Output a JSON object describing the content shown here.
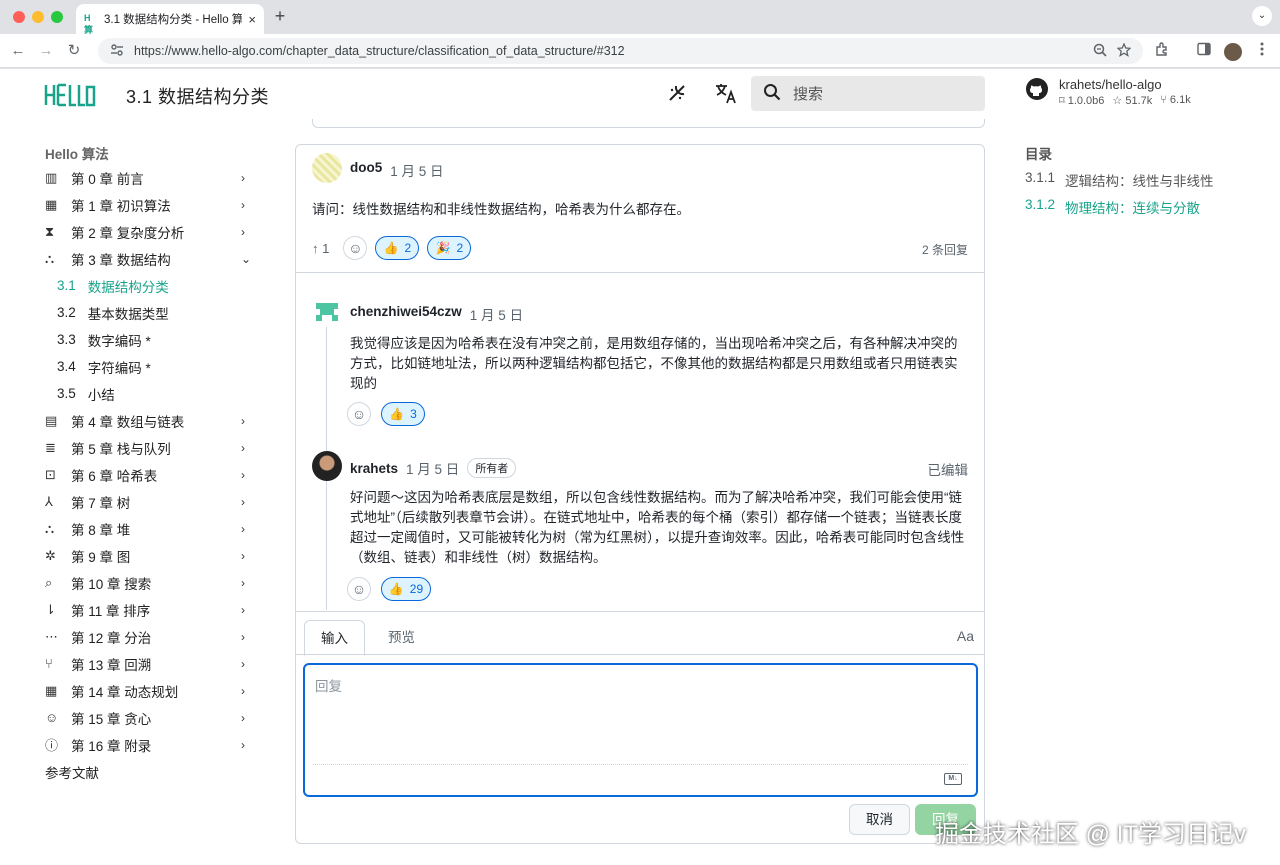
{
  "browser": {
    "tab_title": "3.1  数据结构分类 - Hello 算法",
    "tab_favicon": "H算",
    "tab_close": "×",
    "new_tab": "+",
    "tab_menu": "⌄",
    "url": "https://www.hello-algo.com/chapter_data_structure/classification_of_data_structure/#312",
    "back": "←",
    "forward": "→",
    "reload": "↻"
  },
  "header": {
    "logo_text": "Hello 算法",
    "page_title": "3.1   数据结构分类",
    "search_placeholder": "搜索",
    "repo_name": "krahets/hello-algo",
    "version": "1.0.0b6",
    "stars": "51.7k",
    "forks": "6.1k"
  },
  "sidebar": {
    "title": "Hello 算法",
    "items": [
      {
        "label": "第 0 章   前言",
        "icon": "book-icon"
      },
      {
        "label": "第 1 章   初识算法",
        "icon": "calculator-icon"
      },
      {
        "label": "第 2 章   复杂度分析",
        "icon": "hourglass-icon"
      },
      {
        "label": "第 3 章   数据结构",
        "icon": "shapes-icon"
      }
    ],
    "sub_items": [
      {
        "num": "3.1",
        "label": "数据结构分类"
      },
      {
        "num": "3.2",
        "label": "基本数据类型"
      },
      {
        "num": "3.3",
        "label": "数字编码 *"
      },
      {
        "num": "3.4",
        "label": "字符编码 *"
      },
      {
        "num": "3.5",
        "label": "小结"
      }
    ],
    "items2": [
      {
        "label": "第 4 章   数组与链表",
        "icon": "table-icon"
      },
      {
        "label": "第 5 章   栈与队列",
        "icon": "stack-icon"
      },
      {
        "label": "第 6 章   哈希表",
        "icon": "hash-search-icon"
      },
      {
        "label": "第 7 章   树",
        "icon": "tree-icon"
      },
      {
        "label": "第 8 章   堆",
        "icon": "heap-icon"
      },
      {
        "label": "第 9 章   图",
        "icon": "graph-icon"
      },
      {
        "label": "第 10 章   搜索",
        "icon": "search-list-icon"
      },
      {
        "label": "第 11 章   排序",
        "icon": "sort-icon"
      },
      {
        "label": "第 12 章   分治",
        "icon": "split-icon"
      },
      {
        "label": "第 13 章   回溯",
        "icon": "backtrack-icon"
      },
      {
        "label": "第 14 章   动态规划",
        "icon": "grid-icon"
      },
      {
        "label": "第 15 章   贪心",
        "icon": "head-bulb-icon"
      },
      {
        "label": "第 16 章   附录",
        "icon": "help-circle-icon"
      }
    ],
    "references": "参考文献"
  },
  "comments": {
    "main": {
      "author": "doo5",
      "date": "1 月 5 日",
      "body": "请问：线性数据结构和非线性数据结构，哈希表为什么都存在。",
      "upvotes": "1",
      "reaction_thumbs": "2",
      "reaction_tada": "2",
      "replies_count": "2 条回复"
    },
    "reply1": {
      "author": "chenzhiwei54czw",
      "date": "1 月 5 日",
      "body": "我觉得应该是因为哈希表在没有冲突之前，是用数组存储的，当出现哈希冲突之后，有各种解决冲突的方式，比如链地址法，所以两种逻辑结构都包括它，不像其他的数据结构都是只用数组或者只用链表实现的",
      "reaction_thumbs": "3"
    },
    "reply2": {
      "author": "krahets",
      "date": "1 月 5 日",
      "badge": "所有者",
      "edited": "已编辑",
      "body": "好问题～这因为哈希表底层是数组，所以包含线性数据结构。而为了解决哈希冲突，我们可能会使用“链式地址”（后续散列表章节会讲）。在链式地址中，哈希表的每个桶（索引）都存储一个链表；当链表长度超过一定阈值时，又可能被转化为树（常为红黑树），以提升查询效率。因此，哈希表可能同时包含线性（数组、链表）和非线性（树）数据结构。",
      "reaction_thumbs": "29"
    }
  },
  "composer": {
    "tab_input": "输入",
    "tab_preview": "预览",
    "font_toggle": "Aa",
    "placeholder": "回复",
    "cancel": "取消",
    "submit": "回复",
    "markdown_badge": "M↓"
  },
  "toc": {
    "title": "目录",
    "items": [
      {
        "num": "3.1.1",
        "label": "逻辑结构：线性与非线性"
      },
      {
        "num": "3.1.2",
        "label": "物理结构：连续与分散"
      }
    ]
  },
  "watermark": "掘金技术社区 @ IT学习日记v",
  "colors": {
    "accent": "#19a38a",
    "link": "#0969da",
    "reaction_bg": "#ddf4ff",
    "submit_disabled": "#94d3a2"
  }
}
